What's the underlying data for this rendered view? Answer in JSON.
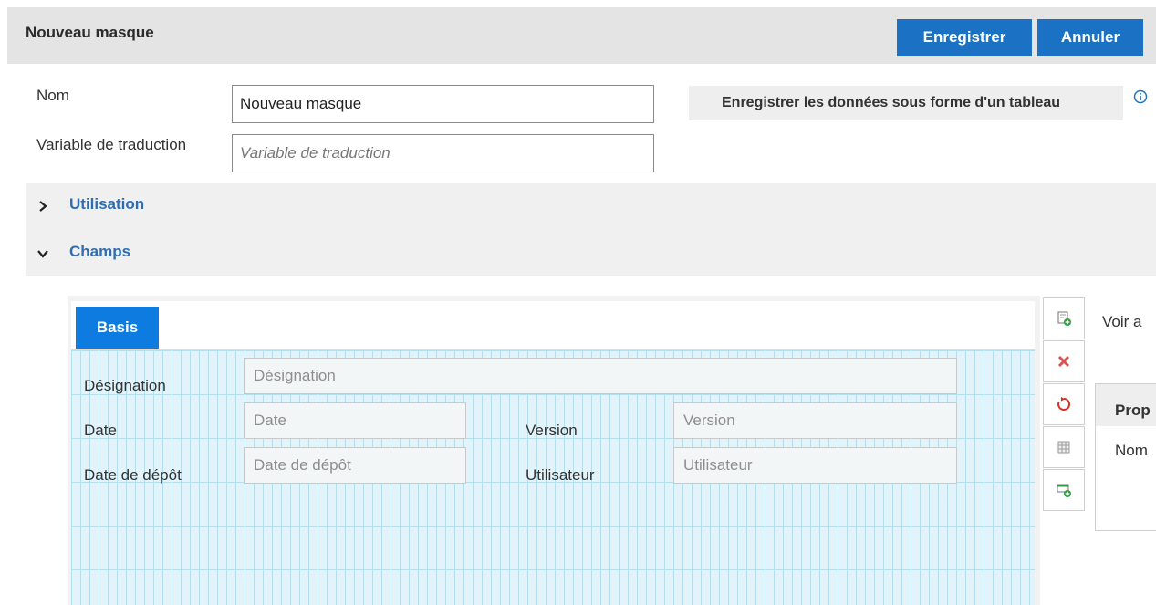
{
  "header": {
    "title": "Nouveau masque",
    "save_label": "Enregistrer",
    "cancel_label": "Annuler"
  },
  "form": {
    "name_label": "Nom",
    "name_value": "Nouveau masque",
    "translation_label": "Variable de traduction",
    "translation_placeholder": "Variable de traduction",
    "table_button_label": "Enregistrer les données sous forme d'un tableau"
  },
  "sections": [
    {
      "label": "Utilisation",
      "expanded": false
    },
    {
      "label": "Champs",
      "expanded": true
    }
  ],
  "designer": {
    "tab_label": "Basis",
    "fields": {
      "designation_label": "Désignation",
      "designation_placeholder": "Désignation",
      "date_label": "Date",
      "date_placeholder": "Date",
      "version_label": "Version",
      "version_placeholder": "Version",
      "deposit_label": "Date de dépôt",
      "deposit_placeholder": "Date de dépôt",
      "user_label": "Utilisateur",
      "user_placeholder": "Utilisateur"
    }
  },
  "toolbar_icons": [
    "add-field-icon",
    "delete-icon",
    "reset-icon",
    "grid-icon",
    "add-row-icon"
  ],
  "side_panel": {
    "voir_label": "Voir a",
    "properties_header": "Prop",
    "name_row": "Nom"
  },
  "colors": {
    "primary": "#1b72c4",
    "tab_active": "#0d7be0",
    "section_link": "#2f6db2",
    "delete": "#d9534f",
    "reset": "#d93025",
    "add": "#2e9e3e"
  }
}
